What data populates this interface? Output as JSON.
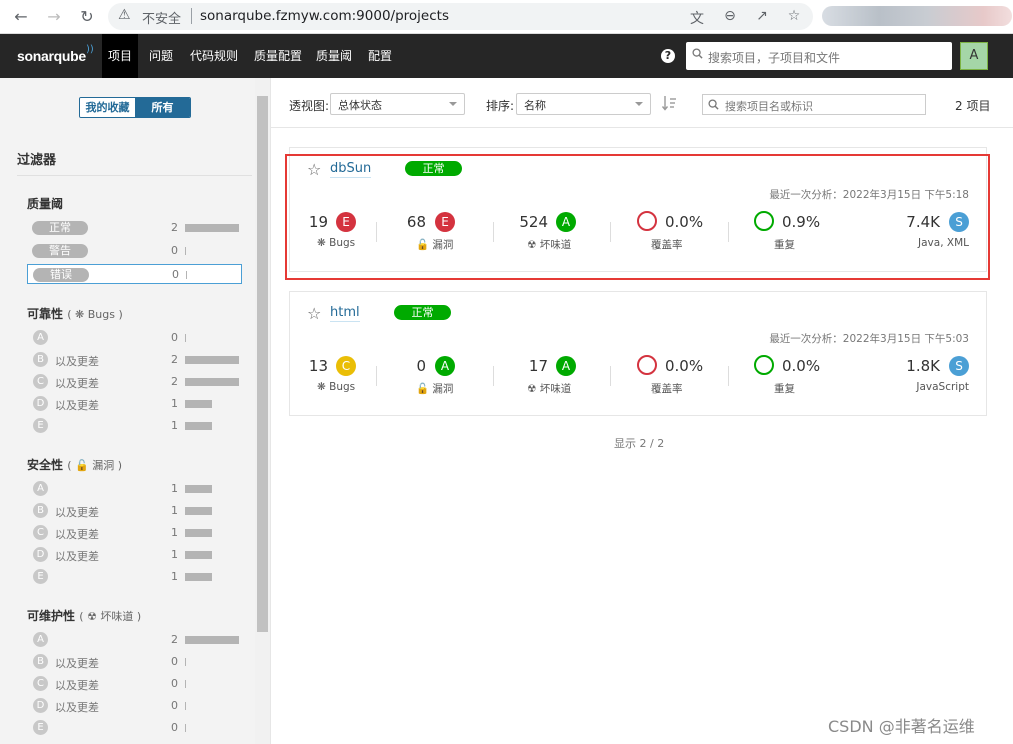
{
  "browser": {
    "insecure_label": "不安全",
    "url": "sonarqube.fzmyw.com:9000/projects"
  },
  "topbar": {
    "logo": "sonarqube",
    "nav": [
      "项目",
      "问题",
      "代码规则",
      "质量配置",
      "质量阈",
      "配置"
    ],
    "active_nav": "项目",
    "search_placeholder": "搜索项目，子项目和文件",
    "avatar_letter": "A"
  },
  "sidebar": {
    "toggle": {
      "favorites": "我的收藏",
      "all": "所有"
    },
    "filters_title": "过滤器",
    "quality_gate": {
      "title": "质量阈",
      "items": [
        {
          "label": "正常",
          "count": "2",
          "fraction": 1.0
        },
        {
          "label": "警告",
          "count": "0",
          "fraction": 0
        },
        {
          "label": "错误",
          "count": "0",
          "fraction": 0
        }
      ]
    },
    "reliability": {
      "title": "可靠性",
      "subtitle": "Bugs",
      "items": [
        {
          "grade": "A",
          "label": "",
          "count": "0",
          "fraction": 0
        },
        {
          "grade": "B",
          "label": "以及更差",
          "count": "2",
          "fraction": 1.0
        },
        {
          "grade": "C",
          "label": "以及更差",
          "count": "2",
          "fraction": 1.0
        },
        {
          "grade": "D",
          "label": "以及更差",
          "count": "1",
          "fraction": 0.5
        },
        {
          "grade": "E",
          "label": "",
          "count": "1",
          "fraction": 0.5
        }
      ]
    },
    "security": {
      "title": "安全性",
      "subtitle": "漏洞",
      "items": [
        {
          "grade": "A",
          "label": "",
          "count": "1",
          "fraction": 0.5
        },
        {
          "grade": "B",
          "label": "以及更差",
          "count": "1",
          "fraction": 0.5
        },
        {
          "grade": "C",
          "label": "以及更差",
          "count": "1",
          "fraction": 0.5
        },
        {
          "grade": "D",
          "label": "以及更差",
          "count": "1",
          "fraction": 0.5
        },
        {
          "grade": "E",
          "label": "",
          "count": "1",
          "fraction": 0.5
        }
      ]
    },
    "maintainability": {
      "title": "可维护性",
      "subtitle": "坏味道",
      "items": [
        {
          "grade": "A",
          "label": "",
          "count": "2",
          "fraction": 1.0
        },
        {
          "grade": "B",
          "label": "以及更差",
          "count": "0",
          "fraction": 0
        },
        {
          "grade": "C",
          "label": "以及更差",
          "count": "0",
          "fraction": 0
        },
        {
          "grade": "D",
          "label": "以及更差",
          "count": "0",
          "fraction": 0
        },
        {
          "grade": "E",
          "label": "",
          "count": "0",
          "fraction": 0
        }
      ]
    }
  },
  "toolbar": {
    "perspective_label": "透视图:",
    "perspective_value": "总体状态",
    "sort_label": "排序:",
    "sort_value": "名称",
    "search_placeholder": "搜索项目名或标识",
    "project_count": "2 项目"
  },
  "projects": [
    {
      "name": "dbSun",
      "quality_gate": "正常",
      "last_analysis": "最近一次分析：2022年3月15日 下午5:18",
      "bugs": {
        "value": "19",
        "grade": "E",
        "label": "Bugs"
      },
      "vulnerabilities": {
        "value": "68",
        "grade": "E",
        "label": "漏洞"
      },
      "code_smells": {
        "value": "524",
        "grade": "A",
        "label": "坏味道"
      },
      "coverage": {
        "value": "0.0%",
        "label": "覆盖率"
      },
      "duplications": {
        "value": "0.9%",
        "label": "重复"
      },
      "size": {
        "value": "7.4K",
        "grade": "S",
        "languages": "Java, XML"
      }
    },
    {
      "name": "html",
      "quality_gate": "正常",
      "last_analysis": "最近一次分析：2022年3月15日 下午5:03",
      "bugs": {
        "value": "13",
        "grade": "C",
        "label": "Bugs"
      },
      "vulnerabilities": {
        "value": "0",
        "grade": "A",
        "label": "漏洞"
      },
      "code_smells": {
        "value": "17",
        "grade": "A",
        "label": "坏味道"
      },
      "coverage": {
        "value": "0.0%",
        "label": "覆盖率"
      },
      "duplications": {
        "value": "0.0%",
        "label": "重复"
      },
      "size": {
        "value": "1.8K",
        "grade": "S",
        "languages": "JavaScript"
      }
    }
  ],
  "shown_text": "显示 2 / 2",
  "watermark": "CSDN @非著名运维"
}
